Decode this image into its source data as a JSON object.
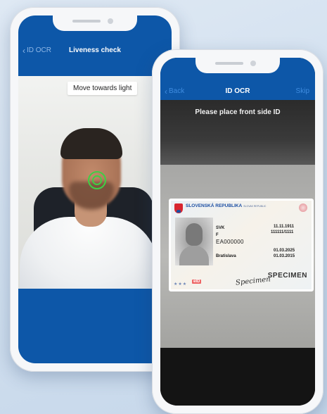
{
  "phone_left": {
    "nav": {
      "back_label": "ID OCR",
      "title": "Liveness check"
    },
    "camera": {
      "hint": "Move towards light"
    }
  },
  "phone_right": {
    "nav": {
      "back_label": "Back",
      "title": "ID OCR",
      "skip_label": "Skip"
    },
    "instruction": "Please place front side ID",
    "id_card": {
      "country": "SLOVENSKÁ REPUBLIKA",
      "country_en": "SLOVAK REPUBLIC",
      "field_a": "SVK",
      "field_b": "F",
      "doc_number": "EA000000",
      "date_1": "11.11.1911",
      "code": "111111/1111",
      "place": "Bratislava",
      "date_2": "01.03.2025",
      "date_3": "01.03.2015",
      "stamp": "SPECIMEN",
      "signature": "Specimen",
      "logo": "eID"
    }
  },
  "colors": {
    "brand_blue": "#0d57a8",
    "link_blue": "#3f8ce0",
    "face_ring_green": "#3fcf45"
  }
}
